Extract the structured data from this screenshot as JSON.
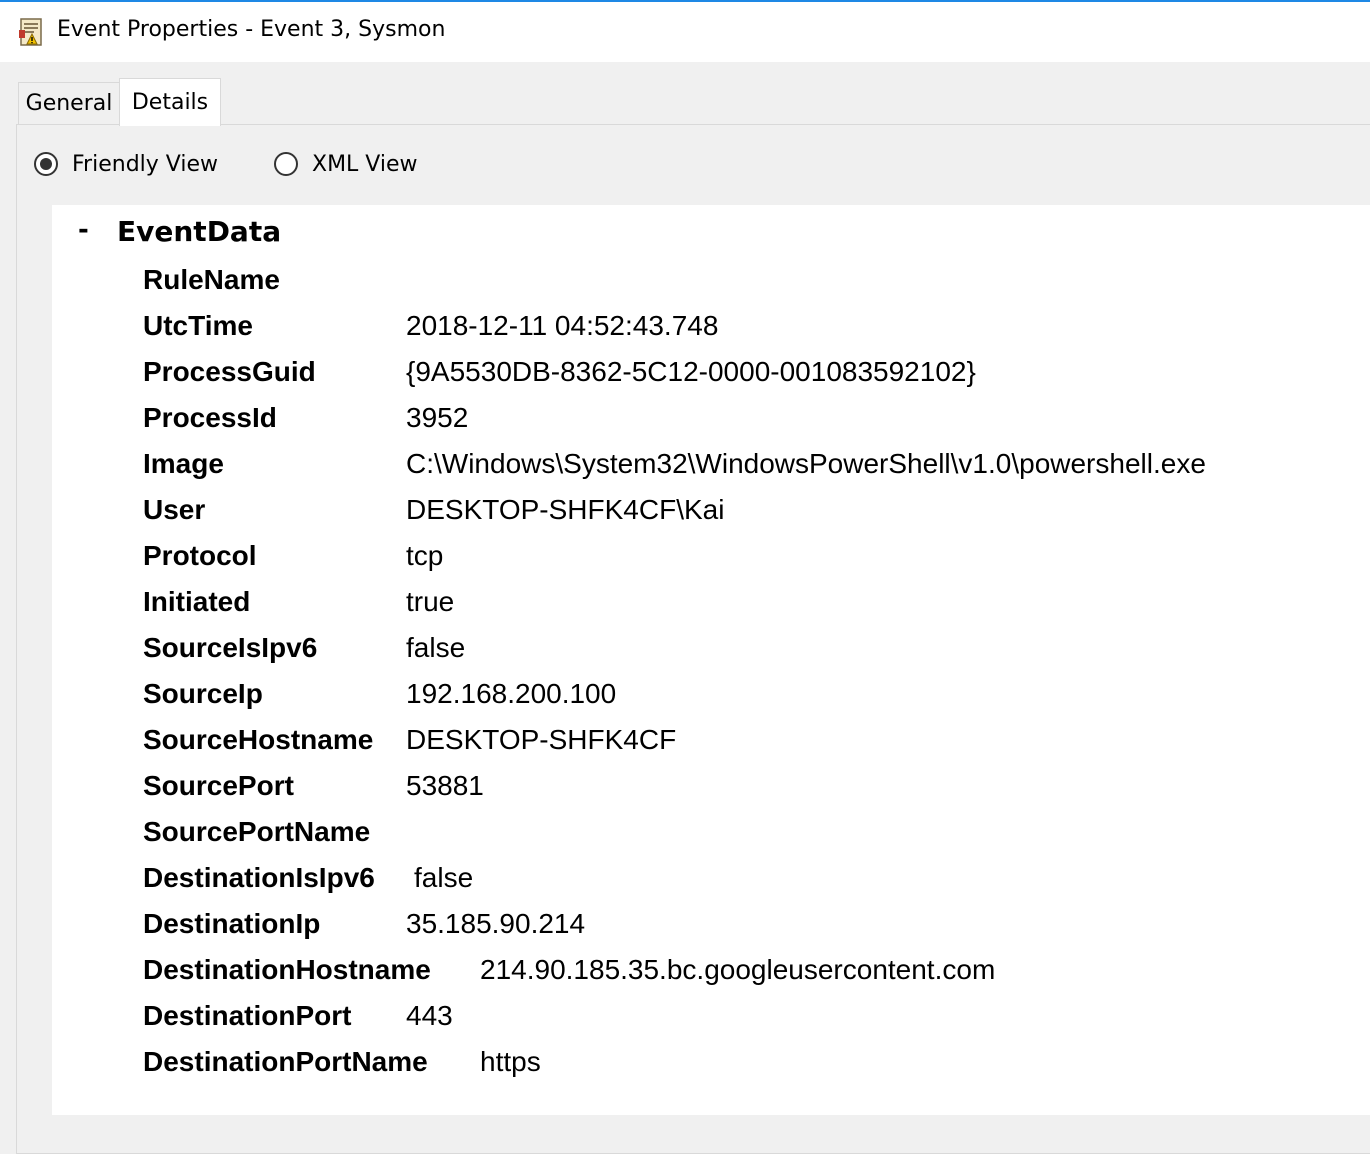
{
  "window": {
    "title": "Event Properties - Event 3, Sysmon",
    "icon": "event-viewer-icon",
    "accent_color": "#1e88e5"
  },
  "tabs": [
    {
      "label": "General",
      "selected": false
    },
    {
      "label": "Details",
      "selected": true
    }
  ],
  "view_options": {
    "friendly": {
      "label": "Friendly View",
      "checked": true
    },
    "xml": {
      "label": "XML View",
      "checked": false
    }
  },
  "event_data": {
    "collapse_sign": "-",
    "label": "EventData",
    "fields": [
      {
        "name": "RuleName",
        "value": ""
      },
      {
        "name": "UtcTime",
        "value": "2018-12-11 04:52:43.748"
      },
      {
        "name": "ProcessGuid",
        "value": "{9A5530DB-8362-5C12-0000-001083592102}"
      },
      {
        "name": "ProcessId",
        "value": "3952"
      },
      {
        "name": "Image",
        "value": "C:\\Windows\\System32\\WindowsPowerShell\\v1.0\\powershell.exe"
      },
      {
        "name": "User",
        "value": "DESKTOP-SHFK4CF\\Kai"
      },
      {
        "name": "Protocol",
        "value": "tcp"
      },
      {
        "name": "Initiated",
        "value": "true"
      },
      {
        "name": "SourceIsIpv6",
        "value": "false"
      },
      {
        "name": "SourceIp",
        "value": "192.168.200.100"
      },
      {
        "name": "SourceHostname",
        "value": "DESKTOP-SHFK4CF"
      },
      {
        "name": "SourcePort",
        "value": "53881"
      },
      {
        "name": "SourcePortName",
        "value": ""
      },
      {
        "name": "DestinationIsIpv6",
        "value": "false"
      },
      {
        "name": "DestinationIp",
        "value": "35.185.90.214"
      },
      {
        "name": "DestinationHostname",
        "value": "214.90.185.35.bc.googleusercontent.com"
      },
      {
        "name": "DestinationPort",
        "value": "443"
      },
      {
        "name": "DestinationPortName",
        "value": "https"
      }
    ]
  }
}
